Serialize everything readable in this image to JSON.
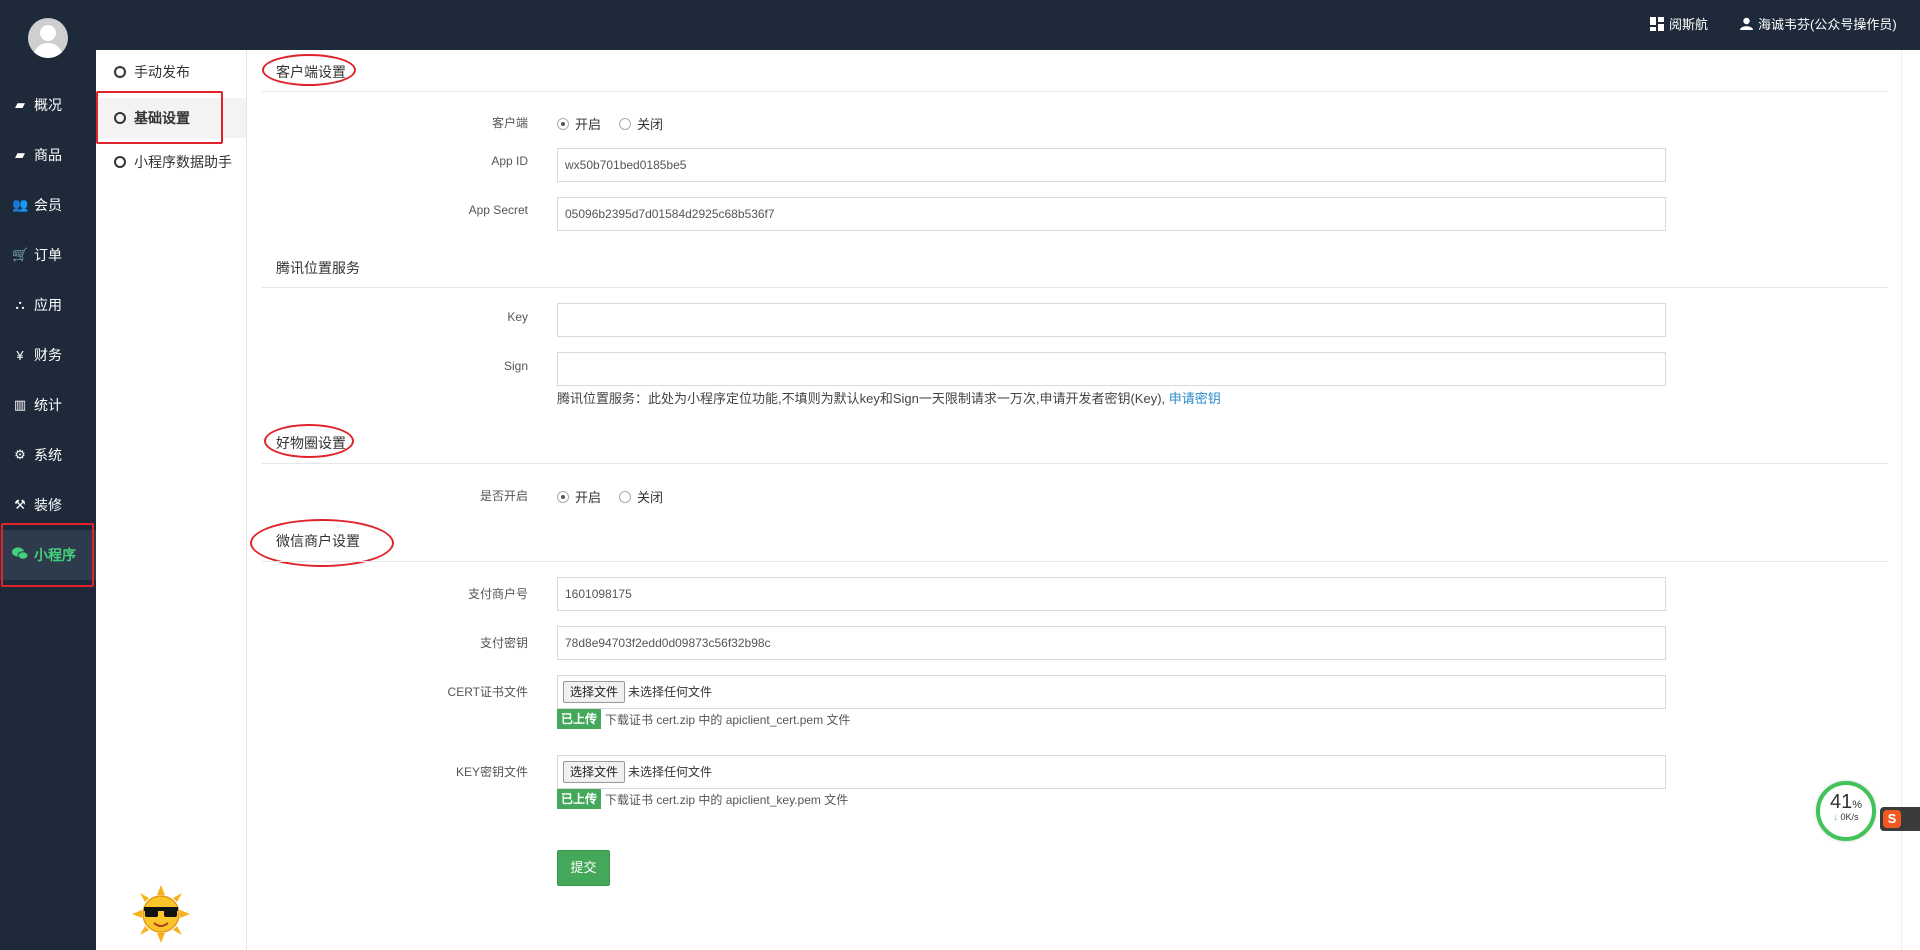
{
  "topbar": {
    "nav_label": "阅斯航",
    "user_label": "海诚韦芬(公众号操作员)"
  },
  "sidebar": {
    "items": [
      {
        "label": "概况",
        "icon": "box-icon"
      },
      {
        "label": "商品",
        "icon": "box-icon"
      },
      {
        "label": "会员",
        "icon": "users-icon"
      },
      {
        "label": "订单",
        "icon": "cart-icon"
      },
      {
        "label": "应用",
        "icon": "cubes-icon"
      },
      {
        "label": "财务",
        "icon": "yen-icon"
      },
      {
        "label": "统计",
        "icon": "bar-chart-icon"
      },
      {
        "label": "系统",
        "icon": "cogs-icon"
      },
      {
        "label": "装修",
        "icon": "hammer-icon"
      },
      {
        "label": "小程序",
        "icon": "wechat-icon"
      }
    ],
    "active": "小程序"
  },
  "subnav": {
    "items": [
      {
        "label": "手动发布"
      },
      {
        "label": "基础设置"
      },
      {
        "label": "小程序数据助手"
      }
    ],
    "active": "基础设置"
  },
  "client_section": {
    "title": "客户端设置",
    "client_label": "客户端",
    "on": "开启",
    "off": "关闭",
    "appid_label": "App ID",
    "appid_value": "wx50b701bed0185be5",
    "secret_label": "App Secret",
    "secret_value": "05096b2395d7d01584d2925c68b536f7"
  },
  "tencent_section": {
    "title": "腾讯位置服务",
    "key_label": "Key",
    "key_value": "",
    "sign_label": "Sign",
    "sign_value": "",
    "help_text": "腾讯位置服务：此处为小程序定位功能,不填则为默认key和Sign一天限制请求一万次,申请开发者密钥(Key),",
    "help_link": "申请密钥"
  },
  "haowu_section": {
    "title": "好物圈设置",
    "enable_label": "是否开启",
    "on": "开启",
    "off": "关闭"
  },
  "wechat_section": {
    "title": "微信商户设置",
    "mchid_label": "支付商户号",
    "mchid_value": "1601098175",
    "paykey_label": "支付密钥",
    "paykey_value": "78d8e94703f2edd0d09873c56f32b98c",
    "cert_label": "CERT证书文件",
    "key_file_label": "KEY密钥文件",
    "choose_file": "选择文件",
    "no_file": "未选择任何文件",
    "uploaded_tag": "已上传",
    "cert_hint": "下载证书 cert.zip 中的 apiclient_cert.pem 文件",
    "key_hint": "下载证书 cert.zip 中的 apiclient_key.pem 文件",
    "submit": "提交"
  },
  "widgets": {
    "speed_percent": "41",
    "speed_unit": "%",
    "speed_rate": "0K/s",
    "ime_letter": "S"
  },
  "colors": {
    "sidebar_bg": "#1e2a3a",
    "active_green": "#44d07a",
    "button_green": "#43a85a",
    "annotation_red": "#e0232a",
    "link_blue": "#2a8ac7"
  }
}
